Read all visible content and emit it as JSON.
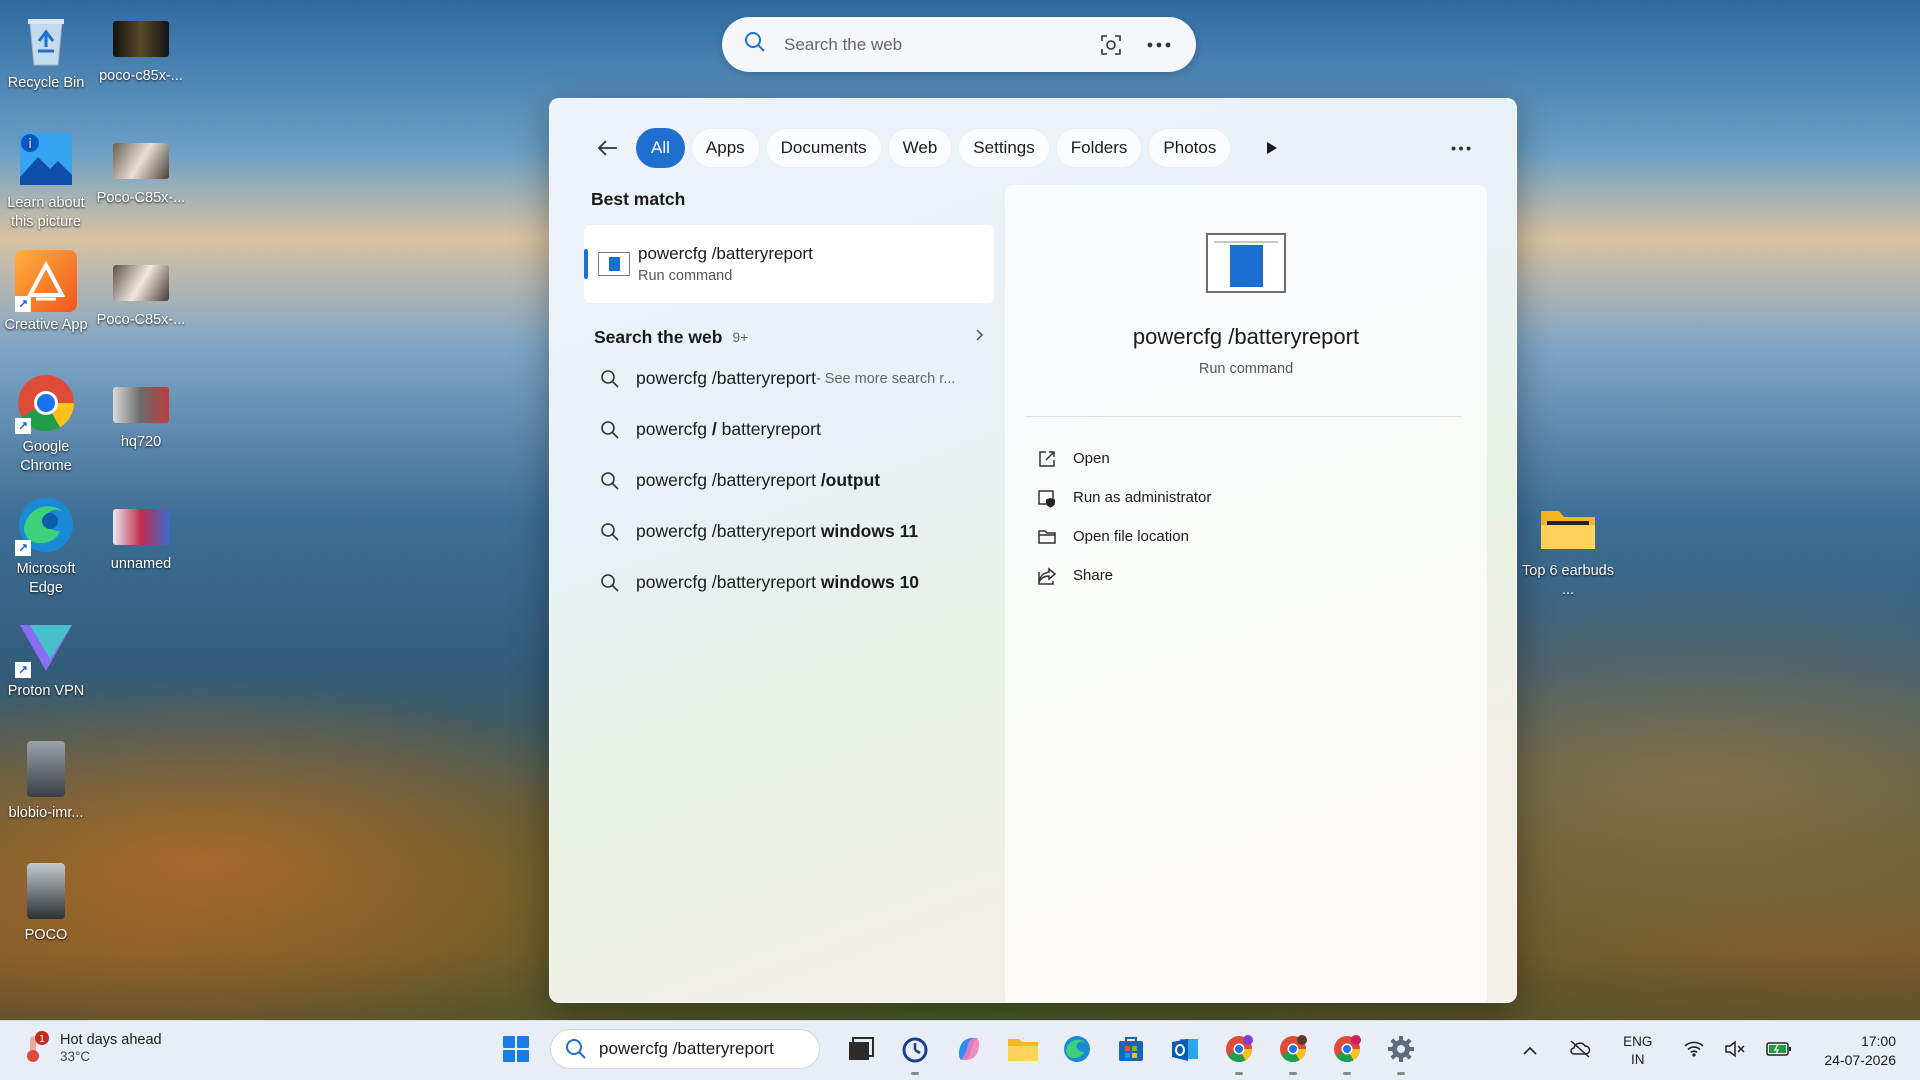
{
  "desktop": {
    "icons_left": [
      {
        "label": "Recycle Bin"
      },
      {
        "label": "Learn about this picture"
      },
      {
        "label": "Creative App"
      },
      {
        "label": "Google Chrome"
      },
      {
        "label": "Microsoft Edge"
      },
      {
        "label": "Proton VPN"
      },
      {
        "label": "blobio-imr..."
      },
      {
        "label": "POCO"
      }
    ],
    "icons_second": [
      {
        "label": "poco-c85x-..."
      },
      {
        "label": "Poco-C85x-..."
      },
      {
        "label": "Poco-C85x-..."
      },
      {
        "label": "hq720"
      },
      {
        "label": "unnamed"
      }
    ],
    "icon_right": {
      "label": "Top 6 earbuds ..."
    }
  },
  "top_search": {
    "placeholder": "Search the web"
  },
  "panel": {
    "filters": [
      "All",
      "Apps",
      "Documents",
      "Web",
      "Settings",
      "Folders",
      "Photos"
    ],
    "active_filter": "All",
    "best_match": {
      "heading": "Best match",
      "title": "powercfg /batteryreport",
      "subtitle": "Run command"
    },
    "web": {
      "heading": "Search the web",
      "count": "9+",
      "suggestions": [
        {
          "base": "powercfg /batteryreport",
          "bold": "",
          "muted": " - See more search r..."
        },
        {
          "base": "powercfg ",
          "bold": "/",
          "rest": " batteryreport"
        },
        {
          "base": "powercfg /batteryreport ",
          "bold": "/output"
        },
        {
          "base": "powercfg /batteryreport ",
          "bold": "windows 11"
        },
        {
          "base": "powercfg /batteryreport ",
          "bold": "windows 10"
        }
      ]
    },
    "detail": {
      "title": "powercfg /batteryreport",
      "subtitle": "Run command",
      "actions": [
        "Open",
        "Run as administrator",
        "Open file location",
        "Share"
      ]
    }
  },
  "taskbar": {
    "weather": {
      "text": "Hot days ahead",
      "temp": "33°C",
      "badge": "1"
    },
    "search_text": "powercfg /batteryreport",
    "lang": {
      "line1": "ENG",
      "line2": "IN"
    },
    "clock": {
      "time": "17:00",
      "date": "24-07-2026"
    }
  },
  "colors": {
    "accent": "#1f6fd1"
  }
}
